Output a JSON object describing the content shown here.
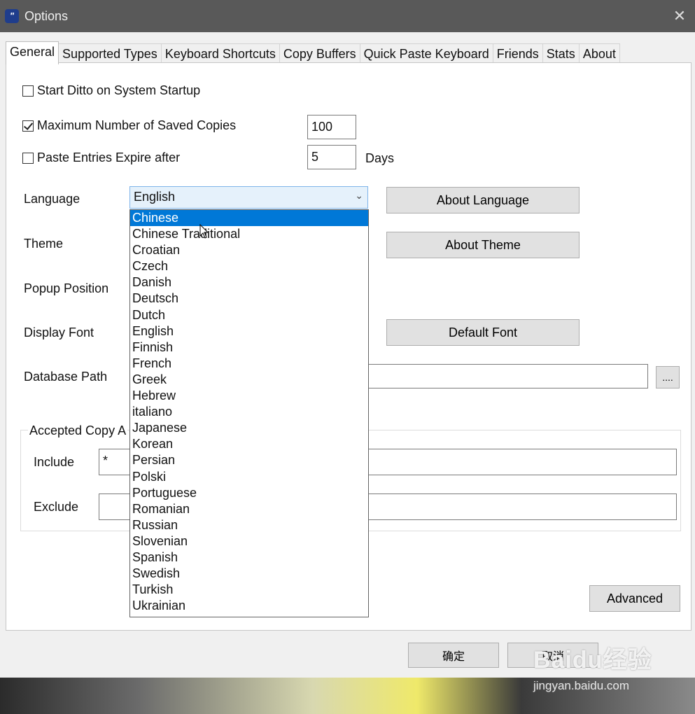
{
  "window": {
    "title": "Options",
    "close": "✕",
    "icon": "\""
  },
  "tabs": [
    "General",
    "Supported Types",
    "Keyboard Shortcuts",
    "Copy Buffers",
    "Quick Paste Keyboard",
    "Friends",
    "Stats",
    "About"
  ],
  "general": {
    "start_on_startup": {
      "label": "Start Ditto on System Startup",
      "checked": false
    },
    "max_saved": {
      "label": "Maximum Number of Saved Copies",
      "checked": true,
      "value": "100"
    },
    "expire": {
      "label": "Paste Entries Expire after",
      "checked": false,
      "value": "5",
      "unit": "Days"
    },
    "language": {
      "label": "Language",
      "selected": "English",
      "about_button": "About Language"
    },
    "theme": {
      "label": "Theme",
      "about_button": "About Theme"
    },
    "popup_position": {
      "label": "Popup Position"
    },
    "display_font": {
      "label": "Display Font",
      "button": "Default Font"
    },
    "database_path": {
      "label": "Database Path",
      "browse": "...."
    },
    "accepted": {
      "title": "Accepted Copy A",
      "include_label": "Include",
      "include_value": "*",
      "exclude_label": "Exclude",
      "exclude_value": ""
    },
    "advanced_button": "Advanced"
  },
  "dropdown_options": [
    "Chinese",
    "Chinese Traditional",
    "Croatian",
    "Czech",
    "Danish",
    "Deutsch",
    "Dutch",
    "English",
    "Finnish",
    "French",
    "Greek",
    "Hebrew",
    "italiano",
    "Japanese",
    "Korean",
    "Persian",
    "Polski",
    "Portuguese",
    "Romanian",
    "Russian",
    "Slovenian",
    "Spanish",
    "Swedish",
    "Turkish",
    "Ukrainian"
  ],
  "dropdown_highlighted": "Chinese",
  "footer": {
    "ok": "确定",
    "cancel": "取消"
  },
  "watermark": {
    "logo": "Baidu经验",
    "url": "jingyan.baidu.com"
  },
  "colors": {
    "accent": "#0078d7",
    "titlebar": "#595959"
  }
}
